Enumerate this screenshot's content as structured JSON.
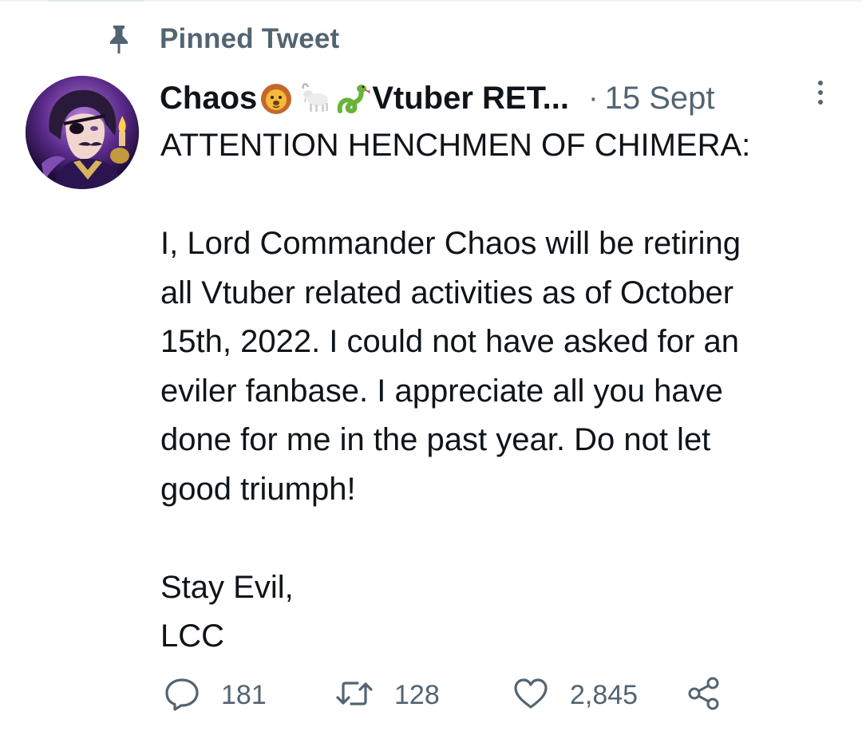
{
  "pinned": {
    "label": "Pinned Tweet",
    "icon": "pin-icon"
  },
  "tweet": {
    "display_name_start": "Chaos",
    "display_name_emojis": [
      "lion-emoji",
      "goat-emoji",
      "snake-emoji"
    ],
    "display_name_rest": "Vtuber RET...",
    "separator": "·",
    "timestamp": "15 Sept",
    "more_icon": "more-vertical-icon",
    "avatar_icon": "avatar-portrait",
    "body_lines": [
      "ATTENTION HENCHMEN OF CHIMERA:",
      "",
      "I, Lord Commander Chaos will be retiring",
      "all Vtuber related activities as of October",
      "15th, 2022. I could not have asked for an",
      "eviler fanbase. I appreciate all you have",
      "done for me in the past year. Do not let",
      "good triumph!",
      "",
      "Stay Evil,",
      "LCC"
    ]
  },
  "actions": {
    "reply": {
      "icon": "reply-icon",
      "count": "181"
    },
    "retweet": {
      "icon": "retweet-icon",
      "count": "128"
    },
    "like": {
      "icon": "heart-icon",
      "count": "2,845"
    },
    "share": {
      "icon": "share-icon"
    }
  },
  "colors": {
    "text_primary": "#0f1419",
    "text_secondary": "#536471",
    "background": "#ffffff"
  }
}
